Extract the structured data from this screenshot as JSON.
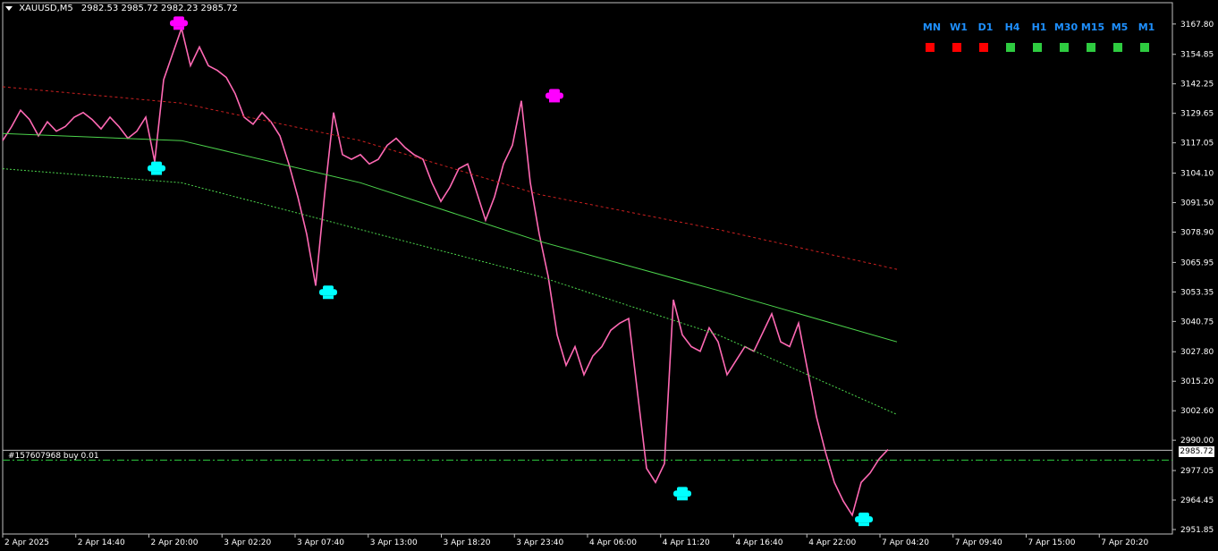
{
  "header": {
    "symbol": "XAUUSD,M5",
    "ohlc": "2982.53 2985.72 2982.23 2985.72"
  },
  "order_label": "#157607968 buy 0.01",
  "current_price_tag": "2985.72",
  "timeframe_panel": [
    {
      "label": "MN",
      "status": "down",
      "color": "#ff0000"
    },
    {
      "label": "W1",
      "status": "down",
      "color": "#ff0000"
    },
    {
      "label": "D1",
      "status": "down",
      "color": "#ff0000"
    },
    {
      "label": "H4",
      "status": "up",
      "color": "#2ecc40"
    },
    {
      "label": "H1",
      "status": "up",
      "color": "#2ecc40"
    },
    {
      "label": "M30",
      "status": "up",
      "color": "#2ecc40"
    },
    {
      "label": "M15",
      "status": "up",
      "color": "#2ecc40"
    },
    {
      "label": "M5",
      "status": "up",
      "color": "#2ecc40"
    },
    {
      "label": "M1",
      "status": "up",
      "color": "#2ecc40"
    }
  ],
  "chart_data": {
    "type": "line",
    "symbol": "XAUUSD",
    "timeframe": "M5",
    "ylim": [
      2951.85,
      3175.0
    ],
    "y_ticks": [
      "3167.80",
      "3154.85",
      "3142.25",
      "3129.65",
      "3117.05",
      "3104.10",
      "3091.50",
      "3078.90",
      "3065.95",
      "3053.35",
      "3040.75",
      "3027.80",
      "3015.20",
      "3002.60",
      "2990.00",
      "2977.05",
      "2964.45",
      "2951.85"
    ],
    "x_ticks": [
      "2 Apr 2025",
      "2 Apr 14:40",
      "2 Apr 20:00",
      "3 Apr 02:20",
      "3 Apr 07:40",
      "3 Apr 13:00",
      "3 Apr 18:20",
      "3 Apr 23:40",
      "4 Apr 06:00",
      "4 Apr 11:20",
      "4 Apr 16:40",
      "4 Apr 22:00",
      "7 Apr 04:20",
      "7 Apr 09:40",
      "7 Apr 15:00",
      "7 Apr 20:20"
    ],
    "series": [
      {
        "style": "price",
        "color": "#ff69b4",
        "x": [
          0,
          10,
          20,
          30,
          40,
          50,
          60,
          70,
          80,
          90,
          100,
          110,
          120,
          130,
          140,
          150,
          160,
          170,
          180,
          190,
          200,
          210,
          220,
          230,
          240,
          250,
          260,
          270,
          280,
          290,
          300,
          310,
          320,
          330,
          340,
          350,
          360,
          370,
          380,
          390,
          400,
          410,
          420,
          430,
          440,
          450,
          460,
          470,
          480,
          490,
          500,
          510,
          520,
          530,
          540,
          550,
          560,
          570,
          580,
          590,
          600,
          610,
          620,
          630,
          640,
          650,
          660,
          670,
          680,
          690,
          700,
          710,
          720,
          730,
          740,
          750,
          760,
          770,
          780,
          790,
          800,
          810,
          820,
          830,
          840,
          850,
          860,
          870,
          880,
          890,
          900,
          910,
          920,
          930,
          940,
          950,
          960,
          970,
          980,
          990
        ],
        "y": [
          3118,
          3124,
          3131,
          3127,
          3120,
          3126,
          3122,
          3124,
          3128,
          3130,
          3127,
          3123,
          3128,
          3124,
          3119,
          3122,
          3128,
          3109,
          3144,
          3155,
          3166,
          3150,
          3158,
          3150,
          3148,
          3145,
          3138,
          3128,
          3125,
          3130,
          3126,
          3120,
          3108,
          3094,
          3078,
          3056,
          3095,
          3130,
          3112,
          3110,
          3112,
          3108,
          3110,
          3116,
          3119,
          3115,
          3112,
          3110,
          3100,
          3092,
          3098,
          3106,
          3108,
          3096,
          3084,
          3094,
          3108,
          3116,
          3135,
          3100,
          3078,
          3060,
          3035,
          3022,
          3030,
          3018,
          3026,
          3030,
          3037,
          3040,
          3042,
          3010,
          2978,
          2972,
          2980,
          3050,
          3035,
          3030,
          3028,
          3038,
          3032,
          3018,
          3024,
          3030,
          3028,
          3036,
          3044,
          3032,
          3030,
          3040,
          3020,
          3000,
          2985,
          2972,
          2964,
          2958,
          2972,
          2976,
          2982,
          2986
        ]
      },
      {
        "name": "",
        "style": "ma-solid",
        "color": "#4cd44c",
        "x": [
          0,
          200,
          400,
          600,
          800,
          1000
        ],
        "y": [
          3121,
          3118,
          3100,
          3075,
          3054,
          3032
        ]
      },
      {
        "name": "",
        "style": "upper-dashed",
        "color": "#cc2020",
        "x": [
          0,
          200,
          400,
          600,
          800,
          1000
        ],
        "y": [
          3141,
          3134,
          3118,
          3095,
          3080,
          3063
        ]
      },
      {
        "name": "",
        "style": "lower-dotted",
        "color": "#4cd44c",
        "x": [
          0,
          200,
          400,
          600,
          800,
          1000
        ],
        "y": [
          3106,
          3100,
          3080,
          3060,
          3035,
          3001
        ]
      }
    ],
    "signals": [
      {
        "x": 172,
        "y": 3106,
        "type": "buy",
        "color": "#00ffff"
      },
      {
        "x": 197,
        "y": 3168,
        "type": "sell",
        "color": "#ff00ff"
      },
      {
        "x": 364,
        "y": 3053,
        "type": "buy",
        "color": "#00ffff"
      },
      {
        "x": 617,
        "y": 3137,
        "type": "sell",
        "color": "#ff00ff"
      },
      {
        "x": 760,
        "y": 2967,
        "type": "buy",
        "color": "#00ffff"
      },
      {
        "x": 963,
        "y": 2956,
        "type": "buy",
        "color": "#00ffff"
      }
    ],
    "order_line_price": 2981.5,
    "current_price_line": 2985.72,
    "grid": false
  }
}
